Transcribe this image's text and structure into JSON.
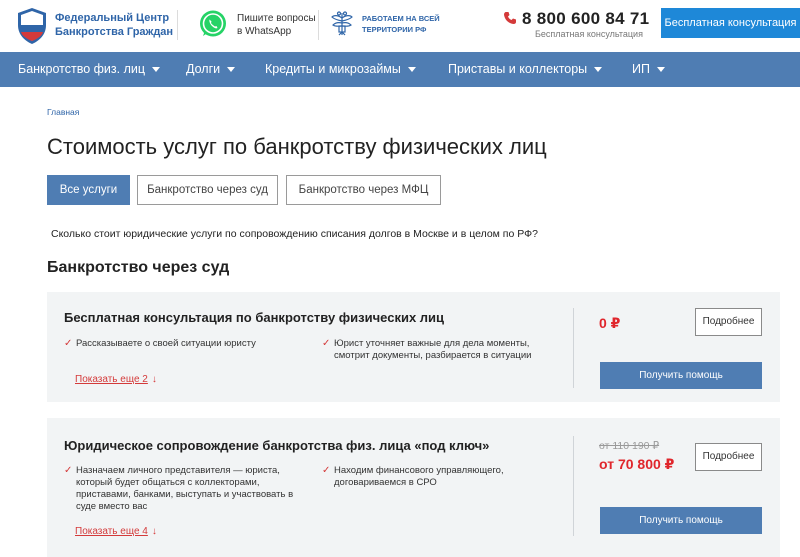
{
  "header": {
    "brand_line1": "Федеральный Центр",
    "brand_line2": "Банкротства Граждан",
    "whatsapp_line1": "Пишите вопросы",
    "whatsapp_line2": "в WhatsApp",
    "territory_line1": "РАБОТАЕМ НА ВСЕЙ",
    "territory_line2": "ТЕРРИТОРИИ РФ",
    "phone": "8 800 600 84 71",
    "phone_caption": "Бесплатная консультация",
    "consult_button": "Бесплатная консультация",
    "icons": [
      "shield-logo-icon",
      "whatsapp-icon",
      "emblem-icon",
      "phone-icon"
    ],
    "colors": {
      "brand": "#2f65a8",
      "cta": "#1e88d8",
      "whatsapp": "#25d366"
    }
  },
  "nav": {
    "items": [
      {
        "label": "Банкротство физ. лиц"
      },
      {
        "label": "Долги"
      },
      {
        "label": "Кредиты и микрозаймы"
      },
      {
        "label": "Приставы и коллекторы"
      },
      {
        "label": "ИП"
      }
    ],
    "color": "#4f7db3"
  },
  "breadcrumb": "Главная",
  "page_title": "Стоимость услуг по банкротству физических лиц",
  "tabs": [
    {
      "label": "Все услуги",
      "active": true
    },
    {
      "label": "Банкротство через суд",
      "active": false
    },
    {
      "label": "Банкротство через МФЦ",
      "active": false
    }
  ],
  "intro": "Сколько стоит юридические услуги по сопровождению списания долгов в Москве и в целом по РФ?",
  "section_title": "Банкротство через суд",
  "services": [
    {
      "title": "Бесплатная консультация по банкротству физических лиц",
      "features": [
        {
          "line1": "Рассказываете о своей ситуации юристу",
          "line2": "",
          "line3": "",
          "line4": ""
        },
        {
          "line1": "Юрист уточняет важные для дела моменты,",
          "line2": "смотрит документы, разбирается в ситуации",
          "line3": "",
          "line4": ""
        }
      ],
      "more_link": "Показать еще 2",
      "old_price": "",
      "price": "0 ₽",
      "details_button": "Подробнее",
      "help_button": "Получить помощь"
    },
    {
      "title": "Юридическое сопровождение банкротства физ. лица «под ключ»",
      "features": [
        {
          "line1": "Назначаем личного представителя — юриста,",
          "line2": "который будет общаться с коллекторами,",
          "line3": "приставами, банками, выступать и участвовать в",
          "line4": "суде вместо вас"
        },
        {
          "line1": "Находим финансового управляющего,",
          "line2": "договариваемся в СРО",
          "line3": "",
          "line4": ""
        }
      ],
      "more_link": "Показать еще 4",
      "old_price": "от 110 190 ₽",
      "price": "от 70 800 ₽",
      "details_button": "Подробнее",
      "help_button": "Получить помощь"
    }
  ],
  "colors": {
    "accent_red": "#e0262c",
    "card_bg": "#f2f4f5"
  }
}
